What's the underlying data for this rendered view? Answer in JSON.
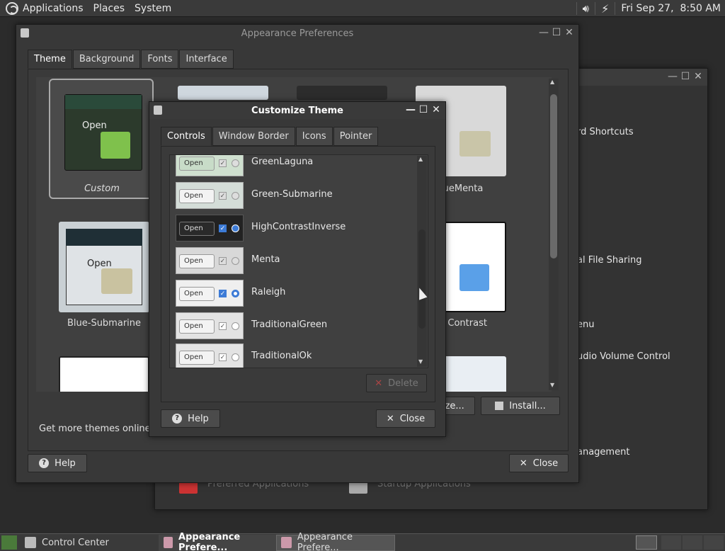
{
  "top_panel": {
    "menus": [
      "Applications",
      "Places",
      "System"
    ],
    "datetime": "Fri Sep 27,  8:50 AM"
  },
  "control_center": {
    "items": [
      "rd Shortcuts",
      "al File Sharing",
      "enu",
      "udio Volume Control",
      "anagement"
    ],
    "bottom_items": [
      "Preferred Applications",
      "Startup Applications"
    ]
  },
  "appearance": {
    "title": "Appearance Preferences",
    "tabs": [
      "Theme",
      "Background",
      "Fonts",
      "Interface"
    ],
    "themes": [
      "Custom",
      "Blue-Submarine",
      "ueMenta",
      "h Contrast"
    ],
    "thumb_open": "Open",
    "get_more": "Get more themes online",
    "customize_btn": "mize...",
    "install_btn": "Install...",
    "help_btn": "Help",
    "close_btn": "Close"
  },
  "customize": {
    "title": "Customize Theme",
    "tabs": [
      "Controls",
      "Window Border",
      "Icons",
      "Pointer"
    ],
    "open_label": "Open",
    "themes": [
      "GreenLaguna",
      "Green-Submarine",
      "HighContrastInverse",
      "Menta",
      "Raleigh",
      "TraditionalGreen",
      "TraditionalOk"
    ],
    "delete_btn": "Delete",
    "help_btn": "Help",
    "close_btn": "Close"
  },
  "taskbar": {
    "items": [
      "Control Center",
      "Appearance Prefere...",
      "Appearance Prefere..."
    ]
  },
  "colors": {
    "panel": "#3a3a3a",
    "window": "#383838",
    "accent": "#3d7bd6"
  }
}
